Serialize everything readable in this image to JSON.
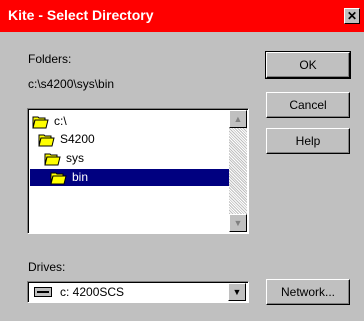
{
  "window": {
    "title": "Kite - Select Directory",
    "close_glyph": "✕"
  },
  "folders": {
    "label": "Folders:",
    "current_path": "c:\\s4200\\sys\\bin",
    "tree": [
      {
        "name": "c:\\",
        "icon": "open-folder-icon"
      },
      {
        "name": "S4200",
        "icon": "open-folder-icon"
      },
      {
        "name": "sys",
        "icon": "open-folder-icon"
      },
      {
        "name": "bin",
        "icon": "open-folder-icon",
        "selected": true
      }
    ]
  },
  "drives": {
    "label": "Drives:",
    "selected": "c: 4200SCS",
    "icon": "hard-drive-icon"
  },
  "buttons": {
    "ok": "OK",
    "cancel": "Cancel",
    "help": "Help",
    "network": "Network..."
  },
  "colors": {
    "title_bar": "#ff0000",
    "selection": "#000080",
    "dialog_bg": "#c0c0c0"
  }
}
